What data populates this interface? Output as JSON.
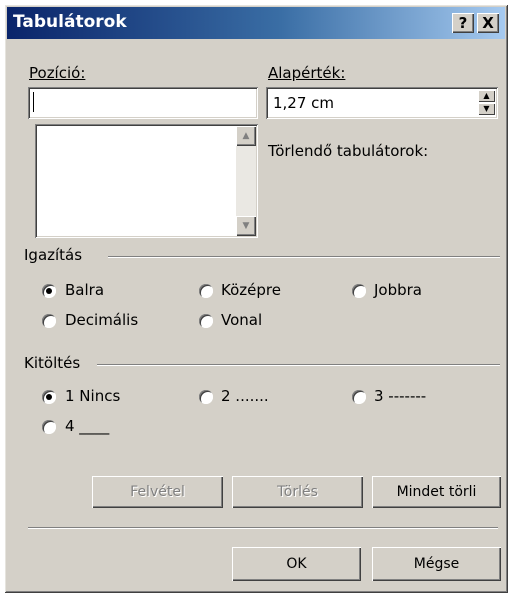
{
  "title": "Tabulátorok",
  "title_buttons": {
    "help": "?",
    "close": "X"
  },
  "position": {
    "label": "Pozíció:",
    "value": ""
  },
  "default": {
    "label": "Alapérték:",
    "value": "1,27 cm"
  },
  "clear_label": "Törlendő tabulátorok:",
  "alignment": {
    "label": "Igazítás",
    "options": [
      "Balra",
      "Középre",
      "Jobbra",
      "Decimális",
      "Vonal"
    ],
    "selected": "Balra"
  },
  "leader": {
    "label": "Kitöltés",
    "options": [
      "1 Nincs",
      "2 .......",
      "3 -------",
      "4 ____"
    ],
    "selected": "1 Nincs"
  },
  "buttons": {
    "set": "Felvétel",
    "clear": "Törlés",
    "clear_all": "Mindet törli",
    "ok": "OK",
    "cancel": "Mégse"
  }
}
